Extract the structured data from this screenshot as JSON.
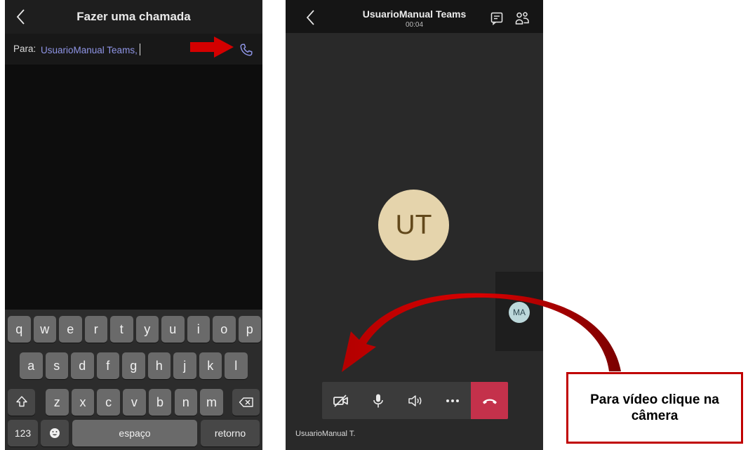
{
  "left_screen": {
    "title": "Fazer uma chamada",
    "to_label": "Para:",
    "to_value": "UsuarioManual Teams,",
    "keyboard": {
      "row1": [
        "q",
        "w",
        "e",
        "r",
        "t",
        "y",
        "u",
        "i",
        "o",
        "p"
      ],
      "row2": [
        "a",
        "s",
        "d",
        "f",
        "g",
        "h",
        "j",
        "k",
        "l"
      ],
      "row3": [
        "z",
        "x",
        "c",
        "v",
        "b",
        "n",
        "m"
      ],
      "numbers_key": "123",
      "space_key": "espaço",
      "return_key": "retorno"
    }
  },
  "right_screen": {
    "caller_name": "UsuarioManual Teams",
    "call_timer": "00:04",
    "avatar_initials": "UT",
    "tile_initials": "MA",
    "participant_label": "UsuarioManual T.",
    "controls": [
      "camera-off-icon",
      "microphone-icon",
      "speaker-icon",
      "more-icon",
      "hang-up-icon"
    ]
  },
  "annotation": {
    "callout_text": "Para vídeo clique na câmera",
    "arrow_color": "#cc0000",
    "border_color": "#c00000"
  },
  "colors": {
    "accent_link": "#8f95e6",
    "hangup": "#c4314b",
    "avatar_main": "#e5d4ac",
    "avatar_tile": "#bcd8db"
  }
}
